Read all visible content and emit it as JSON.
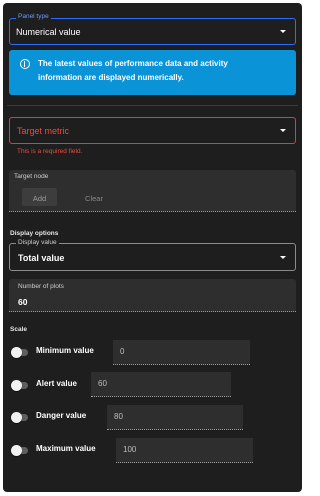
{
  "panel_type": {
    "label": "Panel type",
    "value": "Numerical value"
  },
  "info": {
    "icon": "info-circle-icon",
    "text_line1": "The latest values of performance data and activity",
    "text_line2": "information are displayed numerically."
  },
  "target_metric": {
    "placeholder": "Target metric",
    "error": "This is a required field."
  },
  "target_node": {
    "label": "Target node",
    "add_label": "Add",
    "clear_label": "Clear"
  },
  "display_options": {
    "heading": "Display options",
    "display_value_label": "Display value",
    "display_value": "Total value"
  },
  "plots": {
    "label": "Number of plots",
    "value": "60"
  },
  "scale": {
    "heading": "Scale",
    "items": [
      {
        "label": "Minimum value",
        "value": "0"
      },
      {
        "label": "Alert value",
        "value": "60"
      },
      {
        "label": "Danger value",
        "value": "80"
      },
      {
        "label": "Maximum value",
        "value": "100"
      }
    ]
  },
  "colors": {
    "background": "#1e1e1e",
    "accent": "#2f6df6",
    "info_bg": "#0b93d8",
    "error": "#e53935"
  }
}
